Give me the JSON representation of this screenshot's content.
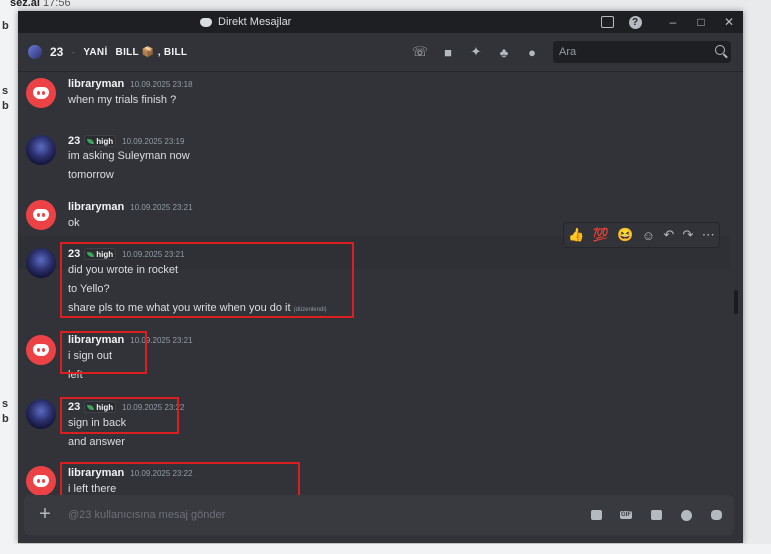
{
  "background": {
    "top_name": "sez.ai",
    "top_time": "17:56",
    "fragments": [
      "b",
      "s",
      "b",
      "s",
      "b"
    ]
  },
  "window": {
    "title": "Direkt Mesajlar",
    "controls": [
      "–",
      "□",
      "✕"
    ]
  },
  "header": {
    "group_count": "23",
    "members_prefix": "YANİ",
    "members_rest": "BILL 📦 , BILL",
    "search_placeholder": "Ara"
  },
  "messages": [
    {
      "author": "libraryman",
      "time": "10.09.2025 23:18",
      "lines": [
        "when my trials finish ?"
      ]
    },
    {
      "author": "23",
      "tag": "high",
      "time": "10.09.2025 23:19",
      "lines": [
        "im asking Suleyman now",
        "tomorrow"
      ]
    },
    {
      "author": "libraryman",
      "time": "10.09.2025 23:21",
      "lines": [
        "ok"
      ]
    },
    {
      "author": "23",
      "tag": "high",
      "time": "10.09.2025 23:21",
      "lines": [
        "did you wrote in rocket",
        "to Yello?",
        "share pls to me what you write when you do it"
      ],
      "edited": "(düzenlendi)"
    },
    {
      "author": "libraryman",
      "time": "10.09.2025 23:21",
      "lines": [
        "i sign out",
        "left"
      ]
    },
    {
      "author": "23",
      "tag": "high",
      "time": "10.09.2025 23:22",
      "lines": [
        "sign in back",
        "and answer"
      ]
    },
    {
      "author": "libraryman",
      "time": "10.09.2025 23:22",
      "lines": [
        "i left there"
      ]
    }
  ],
  "action_bar": [
    "👍",
    "💯",
    "😆",
    "☺",
    "↶",
    "↷",
    "⋯"
  ],
  "composer": {
    "placeholder": "@23 kullanıcısına mesaj gönder",
    "plus": "+"
  },
  "colors": {
    "window_bg": "#313338",
    "titlebar_bg": "#1e1f22",
    "discord_red": "#ed4245",
    "highlight_red": "#d91f1f",
    "tag_green": "#3ba55c"
  }
}
